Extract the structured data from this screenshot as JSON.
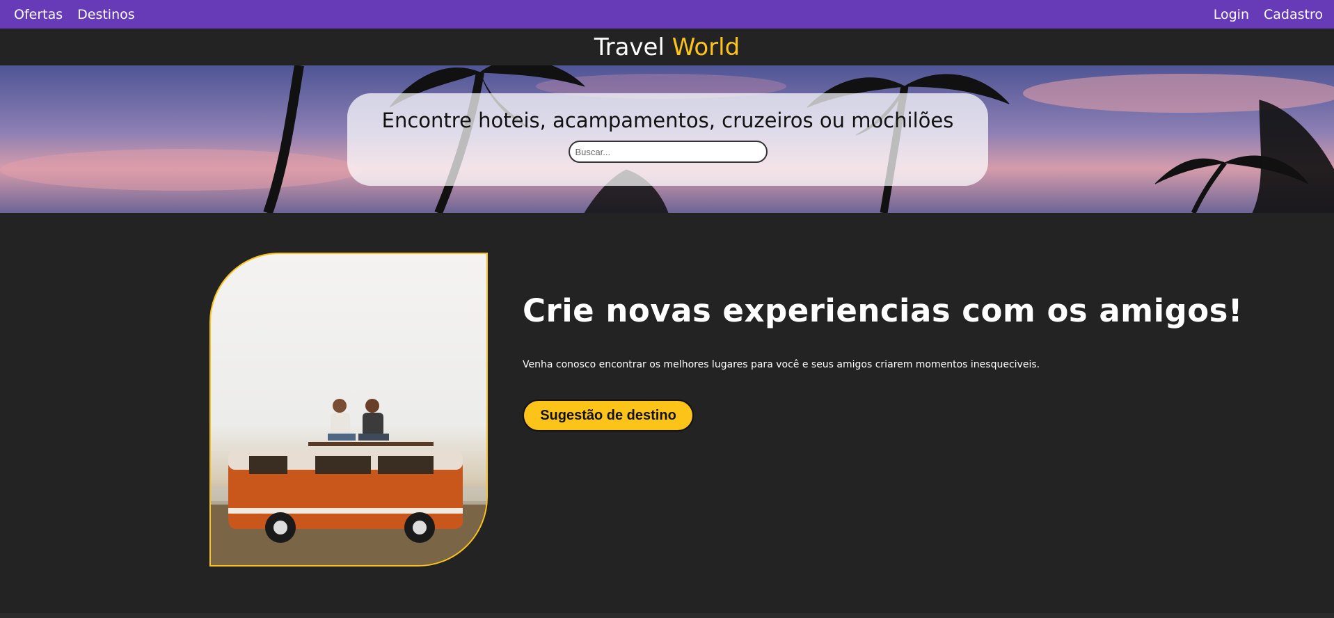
{
  "nav": {
    "left": [
      {
        "label": "Ofertas"
      },
      {
        "label": "Destinos"
      }
    ],
    "right": [
      {
        "label": "Login"
      },
      {
        "label": "Cadastro"
      }
    ]
  },
  "brand": {
    "part1": "Travel",
    "part2": "World"
  },
  "hero": {
    "heading": "Encontre hoteis, acampamentos, cruzeiros ou mochilões",
    "search_placeholder": "Buscar..."
  },
  "feature": {
    "title": "Crie novas experiencias com os amigos!",
    "text": "Venha conosco encontrar os melhores lugares para você e seus amigos criarem momentos inesqueciveis.",
    "button_label": "Sugestão de destino"
  },
  "colors": {
    "nav_bg": "#673ab7",
    "page_bg": "#232323",
    "accent": "#fcc419",
    "text": "#ffffff"
  }
}
